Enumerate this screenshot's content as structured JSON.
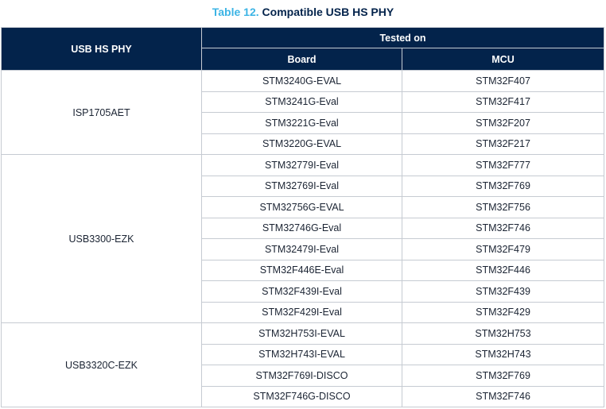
{
  "caption": {
    "number": "Table 12.",
    "title": "Compatible USB HS PHY"
  },
  "headers": {
    "phy": "USB HS PHY",
    "tested_on": "Tested on",
    "board": "Board",
    "mcu": "MCU"
  },
  "groups": [
    {
      "phy": "ISP1705AET",
      "rows": [
        {
          "board": "STM3240G-EVAL",
          "mcu": "STM32F407"
        },
        {
          "board": "STM3241G-Eval",
          "mcu": "STM32F417"
        },
        {
          "board": "STM3221G-Eval",
          "mcu": "STM32F207"
        },
        {
          "board": "STM3220G-EVAL",
          "mcu": "STM32F217"
        }
      ]
    },
    {
      "phy": "USB3300-EZK",
      "rows": [
        {
          "board": "STM32779I-Eval",
          "mcu": "STM32F777"
        },
        {
          "board": "STM32769I-Eval",
          "mcu": "STM32F769"
        },
        {
          "board": "STM32756G-EVAL",
          "mcu": "STM32F756"
        },
        {
          "board": "STM32746G-Eval",
          "mcu": "STM32F746"
        },
        {
          "board": "STM32479I-Eval",
          "mcu": "STM32F479"
        },
        {
          "board": "STM32F446E-Eval",
          "mcu": "STM32F446"
        },
        {
          "board": "STM32F439I-Eval",
          "mcu": "STM32F439"
        },
        {
          "board": "STM32F429I-Eval",
          "mcu": "STM32F429"
        }
      ]
    },
    {
      "phy": "USB3320C-EZK",
      "rows": [
        {
          "board": "STM32H753I-EVAL",
          "mcu": "STM32H753"
        },
        {
          "board": "STM32H743I-EVAL",
          "mcu": "STM32H743"
        },
        {
          "board": "STM32F769I-DISCO",
          "mcu": "STM32F769"
        },
        {
          "board": "STM32F746G-DISCO",
          "mcu": "STM32F746"
        }
      ]
    }
  ]
}
